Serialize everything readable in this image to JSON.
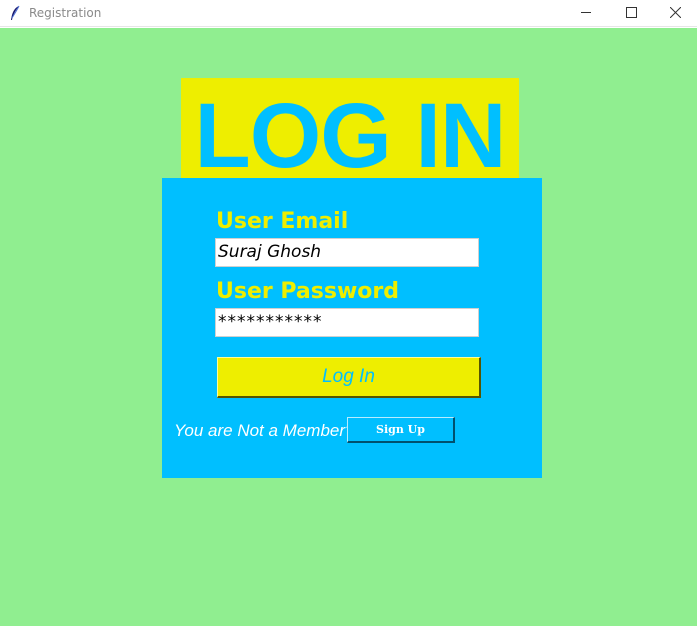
{
  "window": {
    "title": "Registration",
    "app_icon": "feather-icon",
    "controls": {
      "minimize_icon": "minimize-icon",
      "maximize_icon": "maximize-icon",
      "close_icon": "close-icon"
    }
  },
  "colors": {
    "background": "#90ee90",
    "accent_yellow": "#eeee00",
    "accent_blue": "#00bfff"
  },
  "heading": {
    "text": "LOG IN"
  },
  "form": {
    "email_label": "User Email",
    "email_value": "Suraj Ghosh",
    "password_label": "User Password",
    "password_value": "***********",
    "login_button_label": "Log In",
    "member_prompt": "You are Not a Member?",
    "signup_button_label": "Sign Up"
  }
}
